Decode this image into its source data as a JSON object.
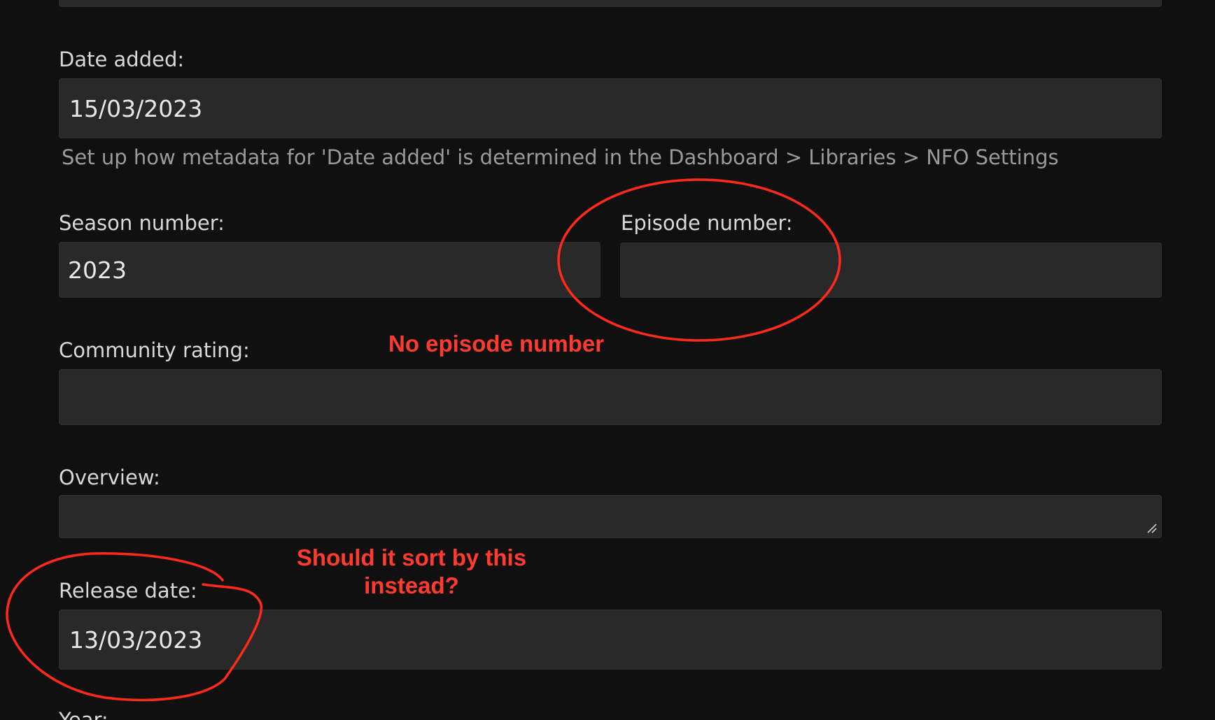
{
  "form": {
    "date_added": {
      "label": "Date added:",
      "value": "15/03/2023",
      "hint": "Set up how metadata for 'Date added' is determined in the Dashboard > Libraries > NFO Settings"
    },
    "season_number": {
      "label": "Season number:",
      "value": "2023"
    },
    "episode_number": {
      "label": "Episode number:",
      "value": ""
    },
    "community_rating": {
      "label": "Community rating:",
      "value": ""
    },
    "overview": {
      "label": "Overview:",
      "value": ""
    },
    "release_date": {
      "label": "Release date:",
      "value": "13/03/2023"
    },
    "year": {
      "label": "Year:"
    }
  },
  "annotations": {
    "no_episode": "No episode number",
    "sort_line1": "Should it sort by this",
    "sort_line2": "instead?",
    "color": "#ff2a1a"
  }
}
